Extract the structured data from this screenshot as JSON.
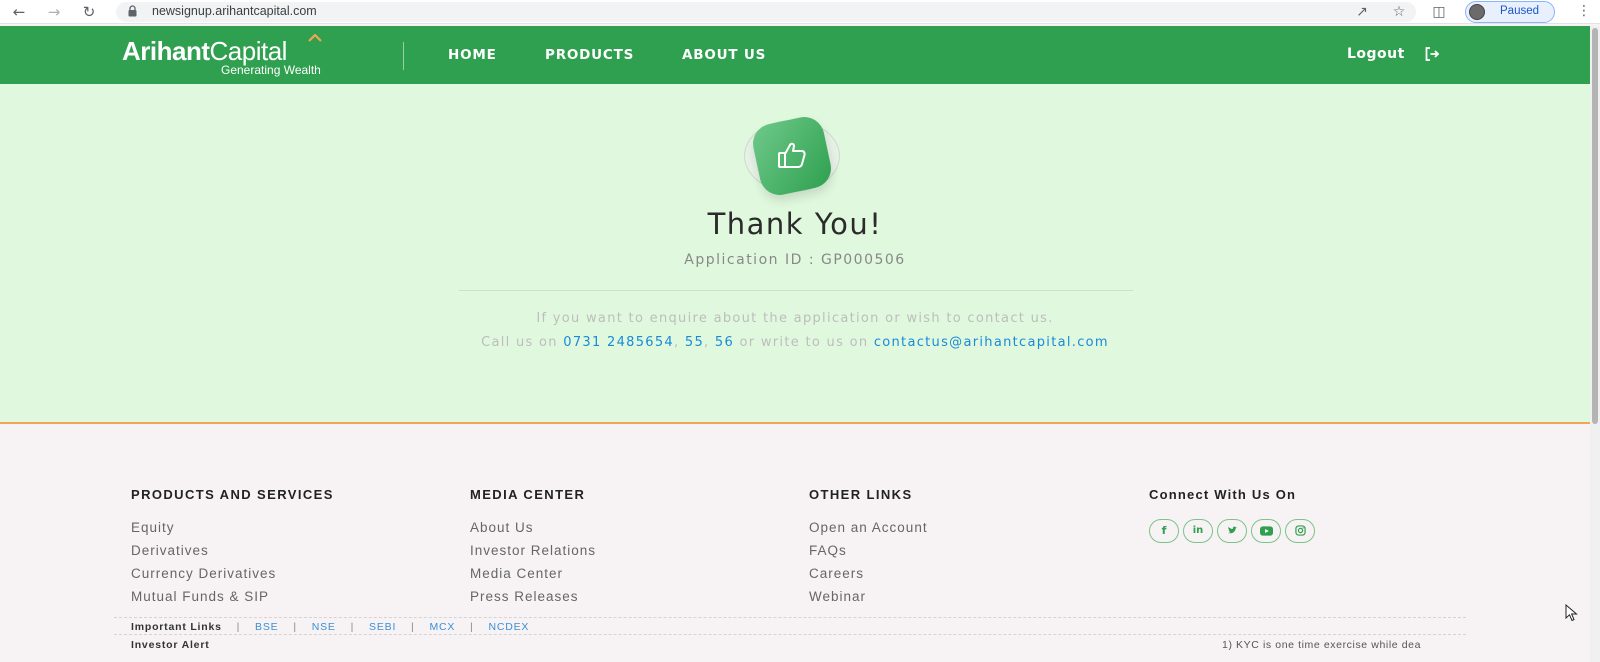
{
  "browser": {
    "url": "newsignup.arihantcapital.com",
    "profile_status": "Paused"
  },
  "header": {
    "brand_bold": "Arihant",
    "brand_light": "Capital",
    "tagline": "Generating Wealth",
    "nav": [
      "HOME",
      "PRODUCTS",
      "ABOUT US"
    ],
    "logout_label": "Logout"
  },
  "main": {
    "title": "Thank You!",
    "application_id": "Application ID : GP000506",
    "enquire_text": "If you want to enquire about the application or wish to contact us.",
    "call_prefix": "Call us on",
    "phone_main": "0731 2485654",
    "phone_ext1": "55",
    "phone_ext2": "56",
    "write_text": "or write to us on",
    "email": "contactus@arihantcapital.com"
  },
  "footer": {
    "columns": [
      {
        "heading": "PRODUCTS AND SERVICES",
        "links": [
          "Equity",
          "Derivatives",
          "Currency Derivatives",
          "Mutual Funds & SIP"
        ]
      },
      {
        "heading": "MEDIA CENTER",
        "links": [
          "About Us",
          "Investor Relations",
          "Media Center",
          "Press Releases"
        ]
      },
      {
        "heading": "OTHER LINKS",
        "links": [
          "Open an Account",
          "FAQs",
          "Careers",
          "Webinar"
        ]
      }
    ],
    "connect_heading": "Connect With Us On",
    "social_icons": [
      "facebook-icon",
      "linkedin-icon",
      "twitter-icon",
      "youtube-icon",
      "instagram-icon"
    ],
    "important_links_label": "Important Links",
    "important_links": [
      "BSE",
      "NSE",
      "SEBI",
      "MCX",
      "NCDEX"
    ],
    "investor_alert_label": "Investor Alert",
    "kyc_ticker": "1) KYC is one time exercise while dea"
  },
  "colors": {
    "header_green": "#2ea04f",
    "main_bg": "#e0f9de",
    "link_blue": "#1a8ad8",
    "accent_orange": "#f0a656"
  }
}
